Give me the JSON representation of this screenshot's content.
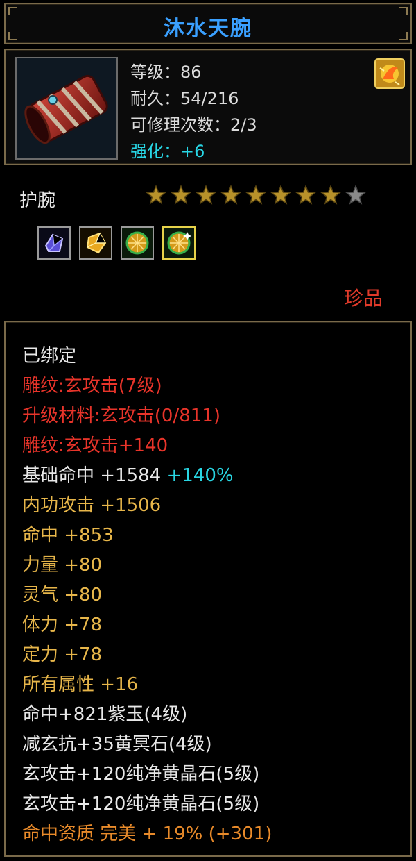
{
  "item": {
    "name": "沐水天腕",
    "level_label": "等级：86",
    "durability_label": "耐久：54/216",
    "repair_label": "可修理次数：2/3",
    "enhance_label": "强化：+6",
    "type": "护腕",
    "stars_total": 9,
    "stars_filled": 8,
    "rarity": "珍品",
    "badge_icon": "enhance-badge-icon",
    "gems": [
      {
        "icon": "purple-jade-gem-icon",
        "selected": false
      },
      {
        "icon": "yellow-stone-gem-icon",
        "selected": false
      },
      {
        "icon": "pure-yellow-crystal-gem-icon",
        "selected": false
      },
      {
        "icon": "pure-yellow-crystal-gem-icon",
        "selected": true
      }
    ]
  },
  "attributes": {
    "bound": "已绑定",
    "engrave1": "雕纹:玄攻击(7级)",
    "upgrade_material": "升级材料:玄攻击(0/811)",
    "engrave2": "雕纹:玄攻击+140",
    "base_hit": "基础命中 +1584",
    "base_hit_pct": "+140%",
    "inner_attack": "内功攻击 +1506",
    "hit": "命中 +853",
    "strength": "力量 +80",
    "spirit": "灵气 +80",
    "stamina": "体力 +78",
    "focus": "定力 +78",
    "all_attr": "所有属性 +16",
    "gem1": "命中+821紫玉(4级)",
    "gem2": "减玄抗+35黄冥石(4级)",
    "gem3": "玄攻击+120纯净黄晶石(5级)",
    "gem4": "玄攻击+120纯净黄晶石(5级)",
    "quality": "命中资质 完美 + 19% (+301)"
  },
  "colors": {
    "title": "#3aa0ff",
    "red": "#e8342a",
    "gold": "#e7b64a",
    "cyan": "#29d6e3",
    "white": "#e8e8e8"
  }
}
